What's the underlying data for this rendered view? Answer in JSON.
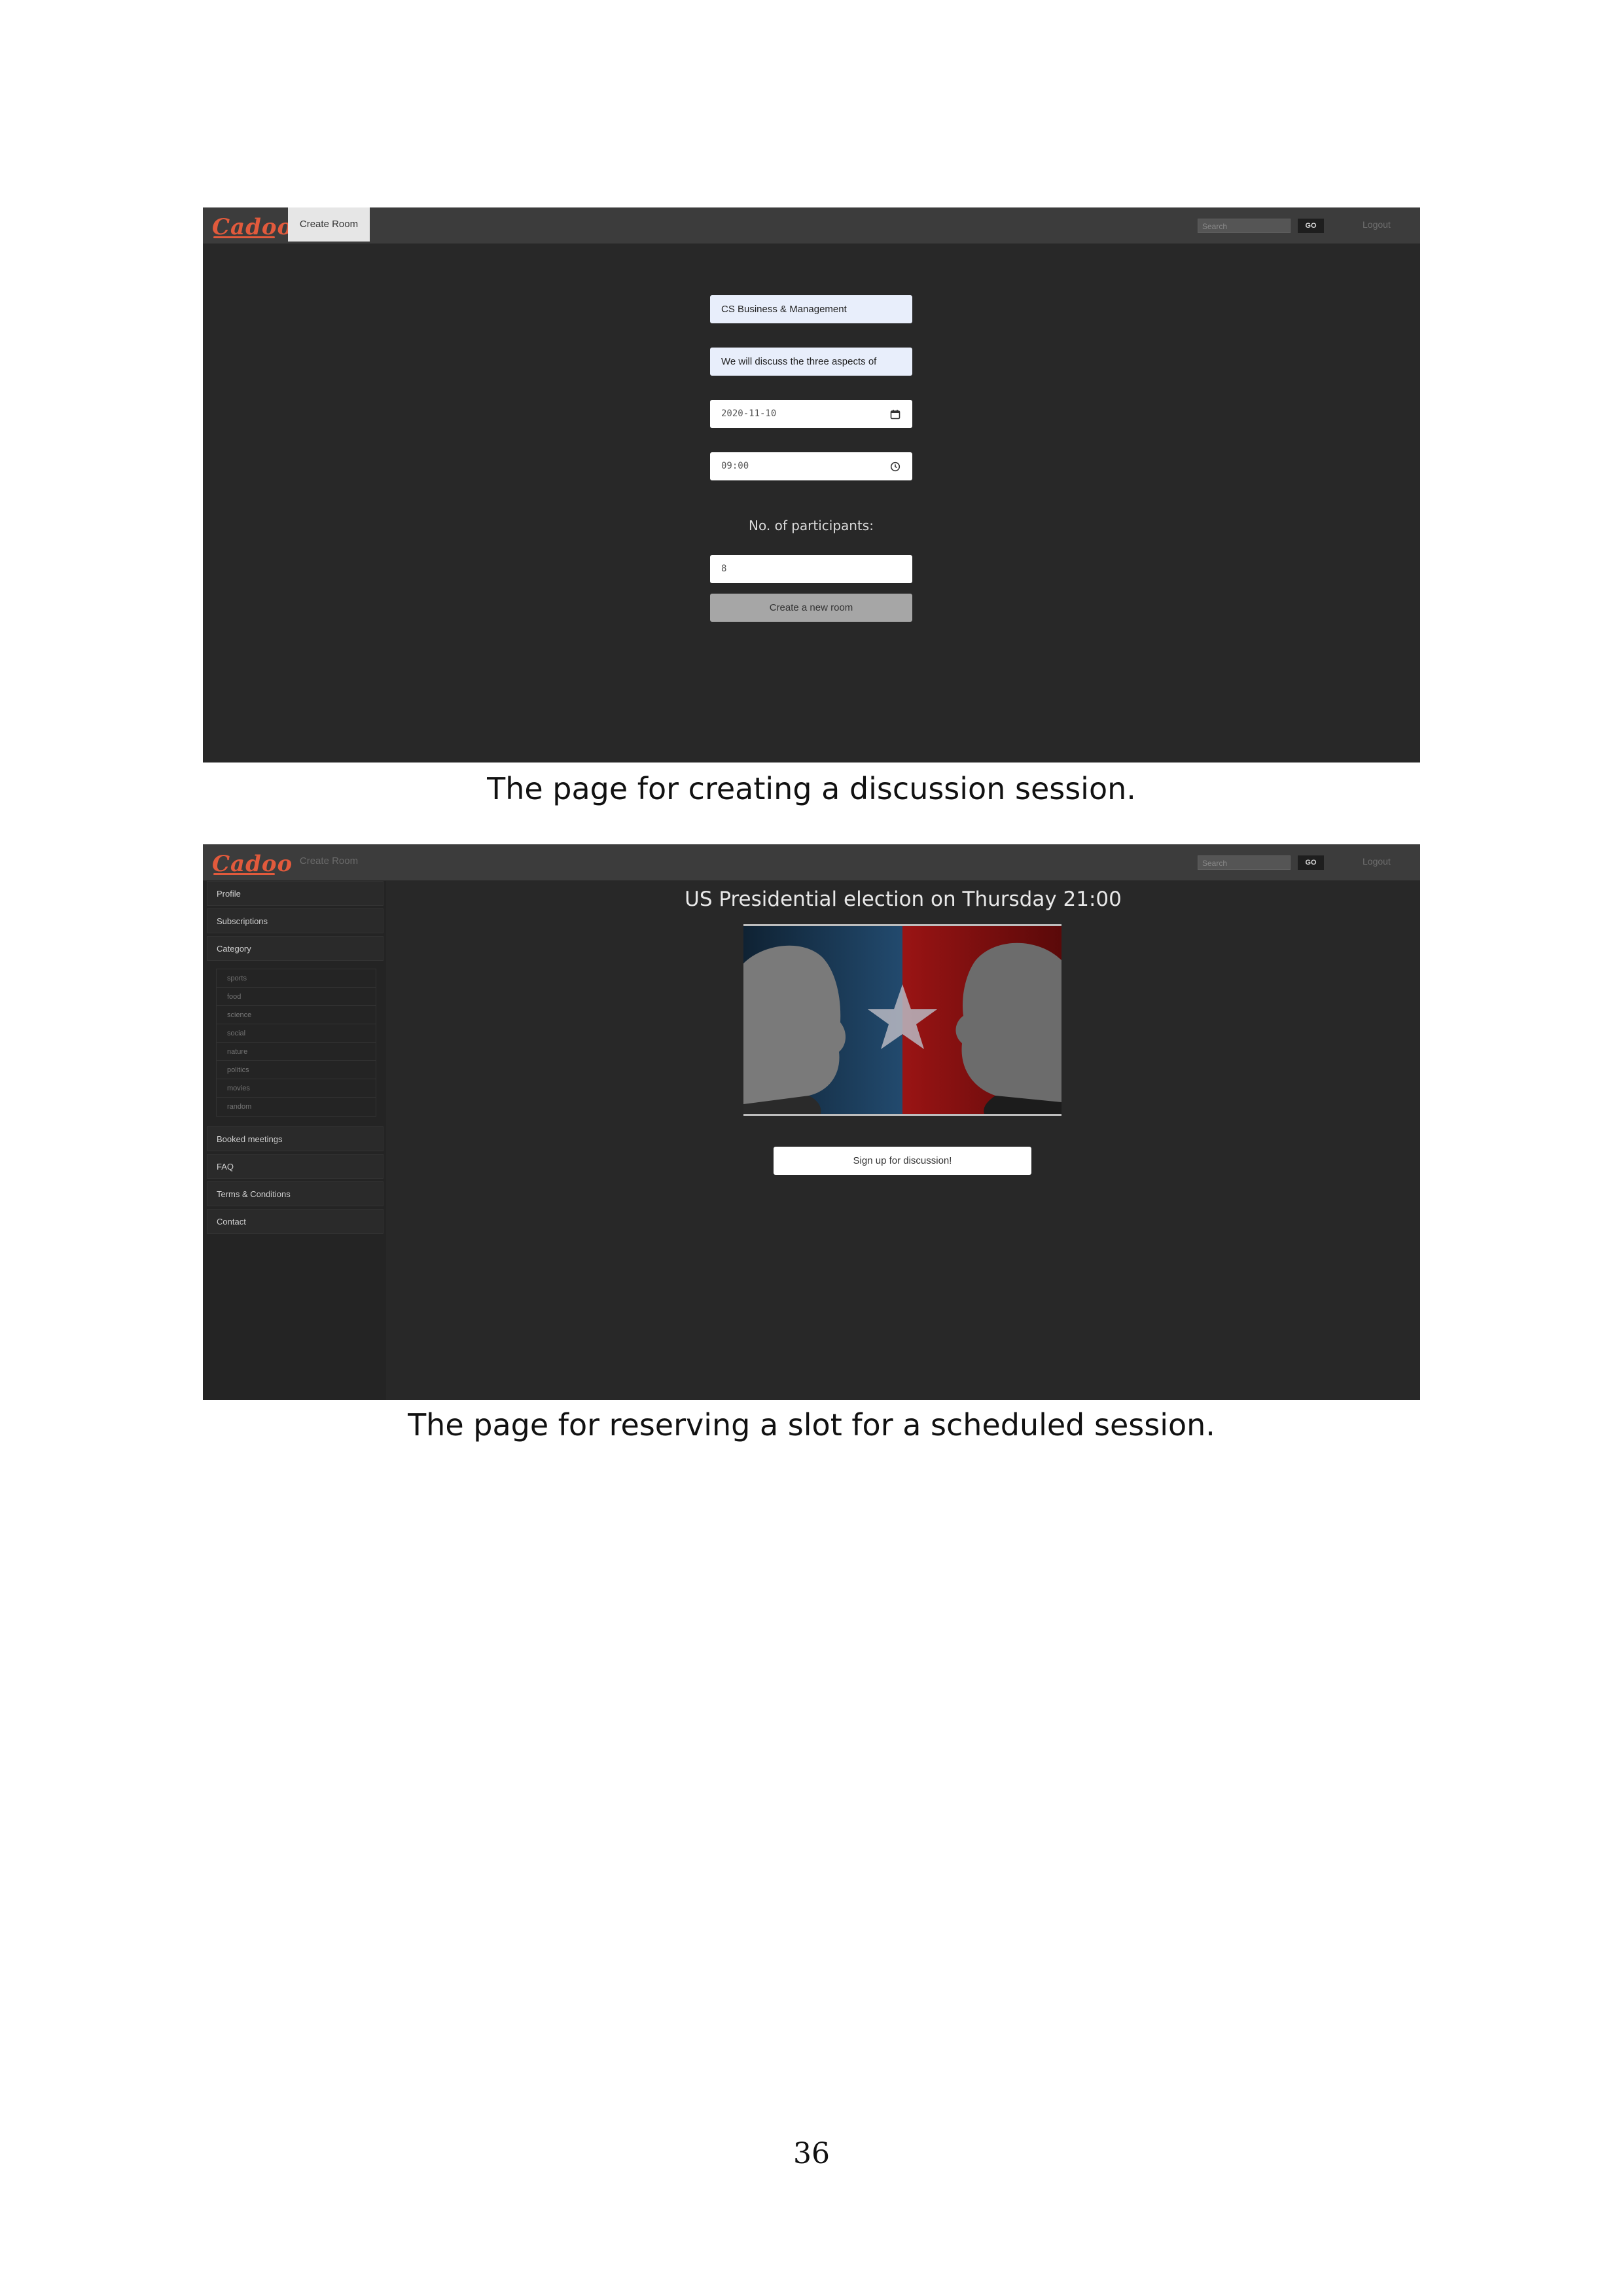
{
  "screen1": {
    "app_name": "Cadoo",
    "nav_tab": "Create Room",
    "search_placeholder": "Search",
    "go_label": "GO",
    "logout_label": "Logout",
    "room_name": "CS Business & Management",
    "room_description": "We will discuss the three aspects of",
    "date": "2020-11-10",
    "time": "09:00",
    "participants_label": "No. of participants:",
    "participants_value": "8",
    "create_button": "Create a new room"
  },
  "caption1": "The page for creating a discussion session.",
  "screen2": {
    "app_name": "Cadoo",
    "nav_tab": "Create Room",
    "search_placeholder": "Search",
    "go_label": "GO",
    "logout_label": "Logout",
    "sidebar": {
      "profile": "Profile",
      "subscriptions": "Subscriptions",
      "category": "Category",
      "categories": [
        "sports",
        "food",
        "science",
        "social",
        "nature",
        "politics",
        "movies",
        "random"
      ],
      "booked": "Booked meetings",
      "faq": "FAQ",
      "terms": "Terms & Conditions",
      "contact": "Contact"
    },
    "session_title": "US Presidential election on Thursday 21:00",
    "signup_button": "Sign up for discussion!",
    "image_colors": {
      "left": "#1f3e5c",
      "right": "#8c1212"
    }
  },
  "caption2": "The page for reserving a slot for a scheduled session.",
  "page_number": "36"
}
